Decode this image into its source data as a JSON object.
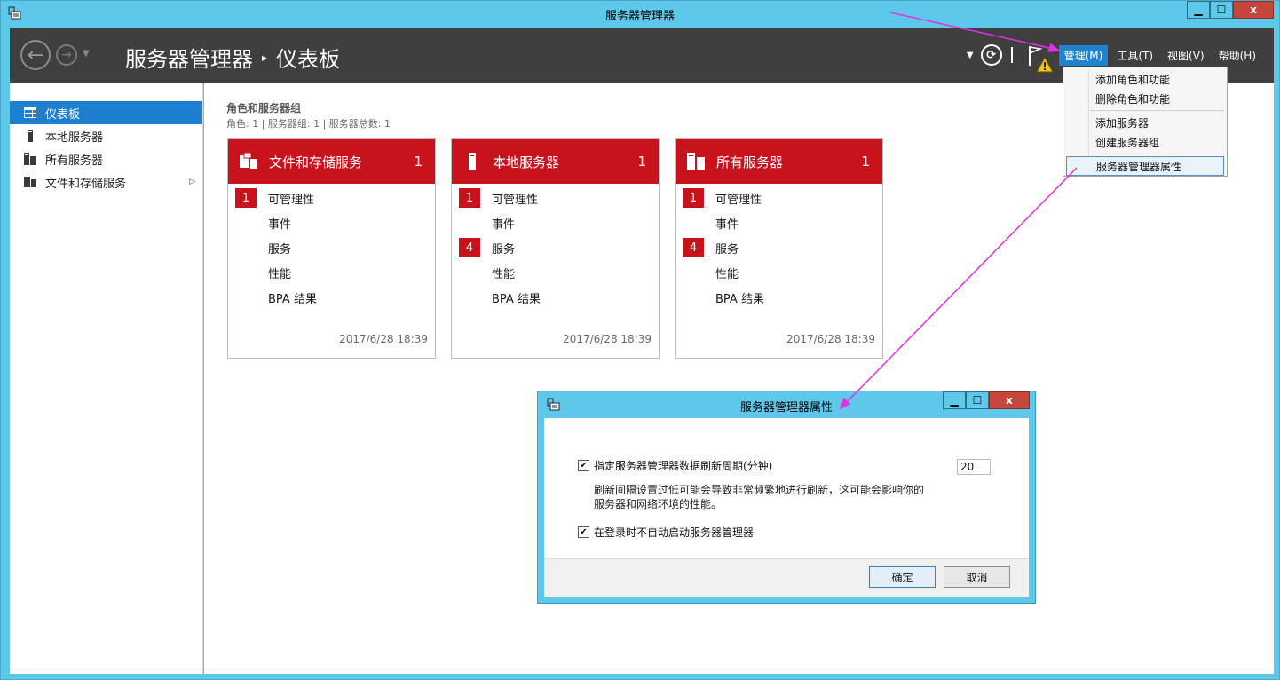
{
  "window": {
    "title": "服务器管理器",
    "min_label": "▁",
    "max_label": "☐",
    "close_label": "x"
  },
  "header": {
    "breadcrumb_root": "服务器管理器",
    "breadcrumb_sep": "▸",
    "breadcrumb_page": "仪表板",
    "menu": {
      "manage": "管理(M)",
      "tools": "工具(T)",
      "view": "视图(V)",
      "help": "帮助(H)"
    }
  },
  "sidebar": {
    "items": [
      {
        "label": "仪表板",
        "icon": "dashboard-icon"
      },
      {
        "label": "本地服务器",
        "icon": "server-icon"
      },
      {
        "label": "所有服务器",
        "icon": "servers-icon"
      },
      {
        "label": "文件和存储服务",
        "icon": "file-storage-icon"
      }
    ]
  },
  "main": {
    "section_title": "角色和服务器组",
    "section_sub": "角色: 1 | 服务器组: 1 | 服务器总数: 1"
  },
  "tiles": [
    {
      "title": "文件和存储服务",
      "count": "1",
      "rows": [
        {
          "badge": "1",
          "label": "可管理性"
        },
        {
          "badge": "",
          "label": "事件"
        },
        {
          "badge": "",
          "label": "服务"
        },
        {
          "badge": "",
          "label": "性能"
        },
        {
          "badge": "",
          "label": "BPA 结果"
        }
      ],
      "date": "2017/6/28 18:39"
    },
    {
      "title": "本地服务器",
      "count": "1",
      "rows": [
        {
          "badge": "1",
          "label": "可管理性"
        },
        {
          "badge": "",
          "label": "事件"
        },
        {
          "badge": "4",
          "label": "服务"
        },
        {
          "badge": "",
          "label": "性能"
        },
        {
          "badge": "",
          "label": "BPA 结果"
        }
      ],
      "date": "2017/6/28 18:39"
    },
    {
      "title": "所有服务器",
      "count": "1",
      "rows": [
        {
          "badge": "1",
          "label": "可管理性"
        },
        {
          "badge": "",
          "label": "事件"
        },
        {
          "badge": "4",
          "label": "服务"
        },
        {
          "badge": "",
          "label": "性能"
        },
        {
          "badge": "",
          "label": "BPA 结果"
        }
      ],
      "date": "2017/6/28 18:39"
    }
  ],
  "manage_menu": {
    "items": [
      "添加角色和功能",
      "删除角色和功能",
      "添加服务器",
      "创建服务器组",
      "服务器管理器属性"
    ]
  },
  "dialog": {
    "title": "服务器管理器属性",
    "refresh_label": "指定服务器管理器数据刷新周期(分钟)",
    "refresh_value": "20",
    "desc_line1": "刷新间隔设置过低可能会导致非常频繁地进行刷新，这可能会影响你的",
    "desc_line2": "服务器和网络环境的性能。",
    "startup_label": "在登录时不自动启动服务器管理器",
    "ok_label": "确定",
    "cancel_label": "取消"
  },
  "colors": {
    "titlebar": "#5ec8ea",
    "header": "#3f3f3f",
    "tile_red": "#c8131d",
    "selected_blue": "#1e7fd0",
    "annotation": "#e52ee5"
  }
}
